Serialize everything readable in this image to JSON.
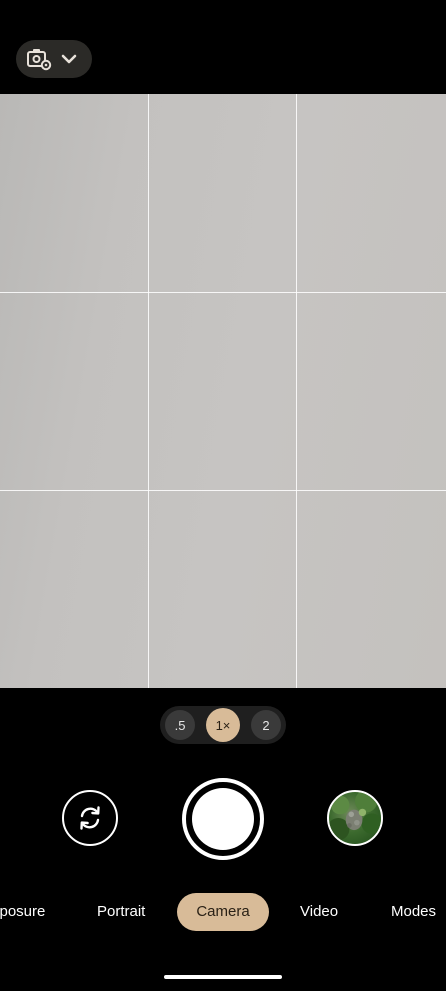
{
  "top_bar": {
    "settings_icon": "camera-settings-icon",
    "expand_icon": "chevron-down-icon"
  },
  "viewfinder": {
    "grid": "3x3"
  },
  "zoom": {
    "options": [
      ".5",
      "1×",
      "2"
    ],
    "selected": "1×"
  },
  "controls": {
    "flip_icon": "camera-flip-icon",
    "shutter_icon": "shutter-button",
    "thumbnail_icon": "last-photo-thumbnail"
  },
  "modes": {
    "items": [
      "xposure",
      "Portrait",
      "Camera",
      "Video",
      "Modes"
    ],
    "selected": "Camera"
  },
  "colors": {
    "accent": "#d8bb98",
    "background": "#000000",
    "pill": "#2b2a27"
  }
}
